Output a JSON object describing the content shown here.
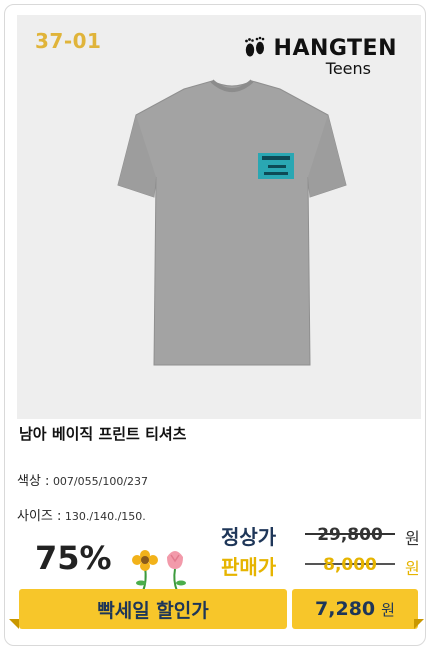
{
  "product": {
    "code": "37-01",
    "brand_name": "HANGTEN",
    "brand_sub": "Teens",
    "title": "남아 베이직 프린트 티셔츠",
    "color_label": "색상 :",
    "color_value": "007/055/100/237",
    "size_label": "사이즈 :",
    "size_value": "130./140./150."
  },
  "pricing": {
    "discount": "75%",
    "regular_label": "정상가",
    "regular_price": "29,800",
    "sale_label": "판매가",
    "sale_price": "8,000",
    "currency": "원"
  },
  "banner": {
    "label": "빡세일 할인가",
    "price": "7,280",
    "currency": "원"
  },
  "colors": {
    "accent_yellow": "#f7c62a",
    "navy": "#1e3658",
    "code_gold": "#e0b43a",
    "shirt_gray": "#a3a3a3"
  },
  "icons": {
    "brand_logo": "footprints-logo",
    "decor": "flowers-decoration"
  }
}
